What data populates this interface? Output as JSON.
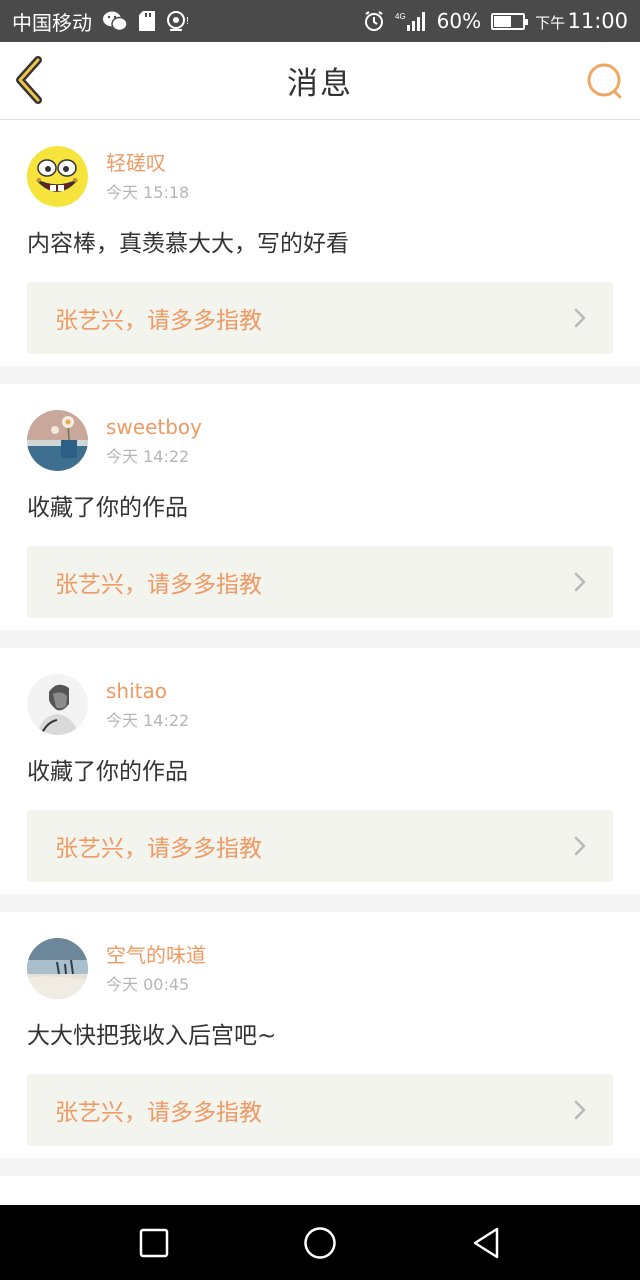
{
  "status_bar": {
    "carrier": "中国移动",
    "battery_percent": "60%",
    "battery_level": 0.6,
    "time_prefix": "下午",
    "time": "11:00",
    "network": "4G"
  },
  "header": {
    "title": "消息",
    "back_icon": "chevron-left-icon",
    "search_icon": "search-icon",
    "accent_color": "#f0a763"
  },
  "messages": [
    {
      "username": "轻磋叹",
      "time": "今天 15:18",
      "content": "内容棒，真羡慕大大，写的好看",
      "quote": "张艺兴，请多多指教",
      "avatar": "spongebob-avatar"
    },
    {
      "username": "sweetboy",
      "time": "今天 14:22",
      "content": "收藏了你的作品",
      "quote": "张艺兴，请多多指教",
      "avatar": "flower-avatar"
    },
    {
      "username": "shitao",
      "time": "今天 14:22",
      "content": "收藏了你的作品",
      "quote": "张艺兴，请多多指教",
      "avatar": "portrait-avatar"
    },
    {
      "username": "空气的味道",
      "time": "今天 00:45",
      "content": "大大快把我收入后宫吧~",
      "quote": "张艺兴，请多多指教",
      "avatar": "landscape-avatar"
    }
  ],
  "colors": {
    "username": "#ef9a63",
    "quote_bg": "#f4f4ef",
    "page_bg": "#f4f4f4"
  }
}
